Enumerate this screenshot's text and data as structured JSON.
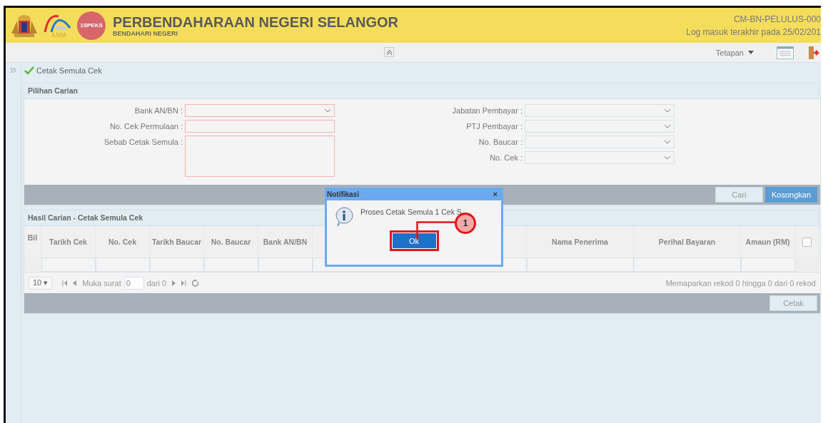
{
  "header": {
    "logos": [
      "ANM",
      "1SPEKS"
    ],
    "title": "PERBENDAHARAAN NEGERI SELANGOR",
    "subtitle": "BENDAHARI NEGERI",
    "user_id": "CM-BN-PELULUS-000",
    "last_login": "Log masuk terakhir pada 25/02/201"
  },
  "toolbar": {
    "settings_menu": "Tetapan"
  },
  "breadcrumb": "Cetak Semula Cek",
  "search_panel": {
    "title": "Pilihan Carian",
    "left_fields": [
      {
        "label": "Bank AN/BN :",
        "kind": "select",
        "required": true
      },
      {
        "label": "No. Cek Permulaan :",
        "kind": "text",
        "required": true
      },
      {
        "label": "Sebab Cetak Semula :",
        "kind": "textarea",
        "required": true
      }
    ],
    "right_fields": [
      {
        "label": "Jabatan Pembayar :",
        "kind": "select",
        "required": false
      },
      {
        "label": "PTJ Pembayar :",
        "kind": "select",
        "required": false
      },
      {
        "label": "No. Baucar :",
        "kind": "select",
        "required": false
      },
      {
        "label": "No. Cek :",
        "kind": "select",
        "required": false
      }
    ],
    "buttons": [
      {
        "label": "Cari",
        "kind": "secondary"
      },
      {
        "label": "Kosongkan",
        "kind": "primary"
      }
    ]
  },
  "results_panel": {
    "title": "Hasil Carian - Cetak Semula Cek",
    "columns": [
      {
        "label": "Bil",
        "kind": "index"
      },
      {
        "label": "Tarikh Cek",
        "kind": "text"
      },
      {
        "label": "No. Cek",
        "kind": "text"
      },
      {
        "label": "Tarikh Baucar",
        "kind": "text"
      },
      {
        "label": "No. Baucar",
        "kind": "text"
      },
      {
        "label": "Bank AN/BN",
        "kind": "text"
      },
      {
        "kind": "covered"
      },
      {
        "label": "Nama Penerima",
        "kind": "wide"
      },
      {
        "label": "Perihal Bayaran",
        "kind": "wide"
      },
      {
        "label": "Amaun (RM)",
        "kind": "text"
      },
      {
        "kind": "checkbox",
        "checked": false
      }
    ],
    "pager": {
      "page_size": "10 ▾",
      "page_label": "Muka surat",
      "page_value": "0",
      "page_total": "dari 0",
      "summary": "Memaparkan rekod 0 hingga 0 dari 0 rekod"
    },
    "buttons": [
      {
        "label": "Cetak",
        "kind": "secondary"
      }
    ]
  },
  "dialog": {
    "title": "Notifikasi",
    "close": "×",
    "message": "Proses Cetak Semula 1 Cek S",
    "button": "Ok",
    "callout": "1"
  }
}
